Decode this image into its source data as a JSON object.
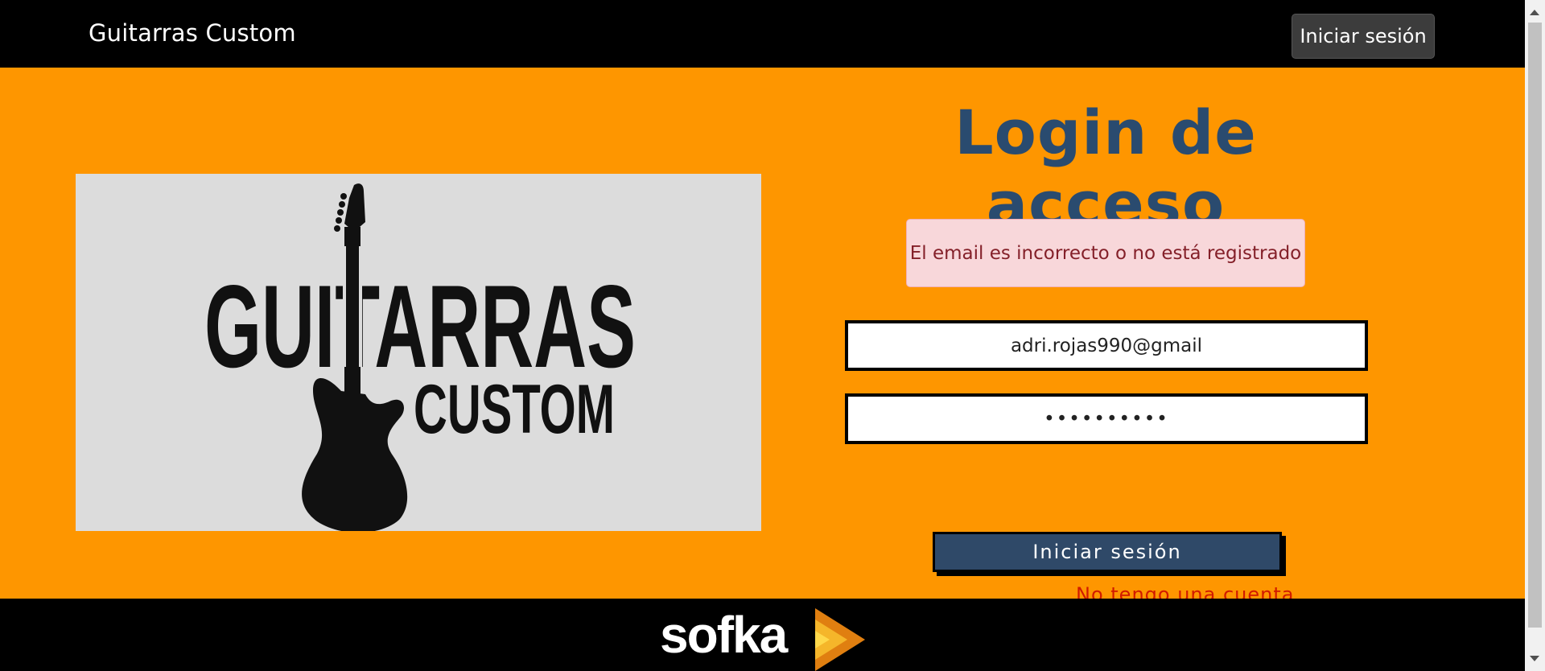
{
  "navbar": {
    "brand": "Guitarras Custom",
    "login_button": "Iniciar sesión"
  },
  "logo": {
    "line1": "GUITARRAS",
    "line2": "CUSTOM",
    "icon": "guitar-icon"
  },
  "form": {
    "title": "Login de acceso",
    "error": "El email es incorrecto o no está registrado",
    "email_value": "adri.rojas990@gmail",
    "password_value": "••••••••••",
    "submit_label": "Iniciar sesión",
    "register_link": "No tengo una cuenta"
  },
  "footer": {
    "logo_text": "sofka"
  },
  "colors": {
    "background": "#fe9600",
    "navbar": "#000000",
    "title": "#2a4b6f",
    "alert_bg": "#f8d7da",
    "alert_text": "#842029",
    "button": "#2f4968",
    "link": "#d11a00"
  }
}
